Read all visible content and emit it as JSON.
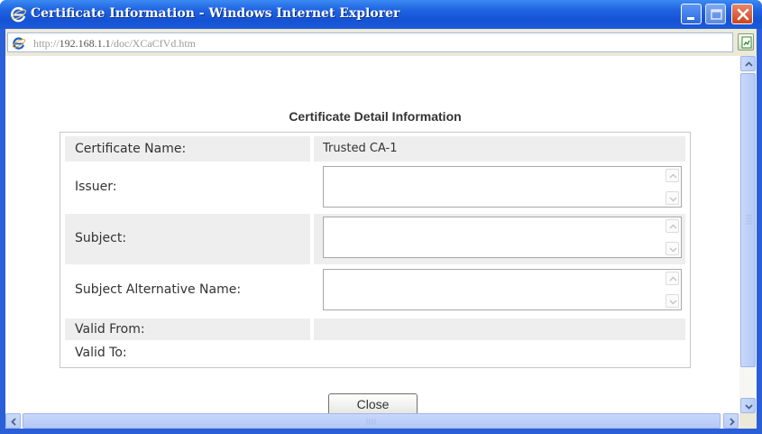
{
  "window": {
    "title": "Certificate Information - Windows Internet Explorer",
    "colors": {
      "titlebar": "#1f63e2",
      "close": "#cc4420",
      "frame": "#2a5fd8"
    },
    "icons": [
      "ie-logo-icon",
      "minimize-icon",
      "maximize-icon",
      "close-icon"
    ]
  },
  "address": {
    "prefix": "http://",
    "host": "192.168.1.1",
    "path": "/doc/XCaCfVd.htm",
    "icons": [
      "ie-page-icon",
      "page-status-icon"
    ]
  },
  "dialog": {
    "heading": "Certificate Detail Information",
    "rows": {
      "certificate_name": {
        "label": "Certificate Name:",
        "value": "Trusted CA-1"
      },
      "issuer": {
        "label": "Issuer:",
        "value": ""
      },
      "subject": {
        "label": "Subject:",
        "value": ""
      },
      "subject_alt_name": {
        "label": "Subject Alternative Name:",
        "value": ""
      },
      "valid_from": {
        "label": "Valid From:",
        "value": ""
      },
      "valid_to": {
        "label": "Valid To:",
        "value": ""
      }
    },
    "close_label": "Close"
  }
}
